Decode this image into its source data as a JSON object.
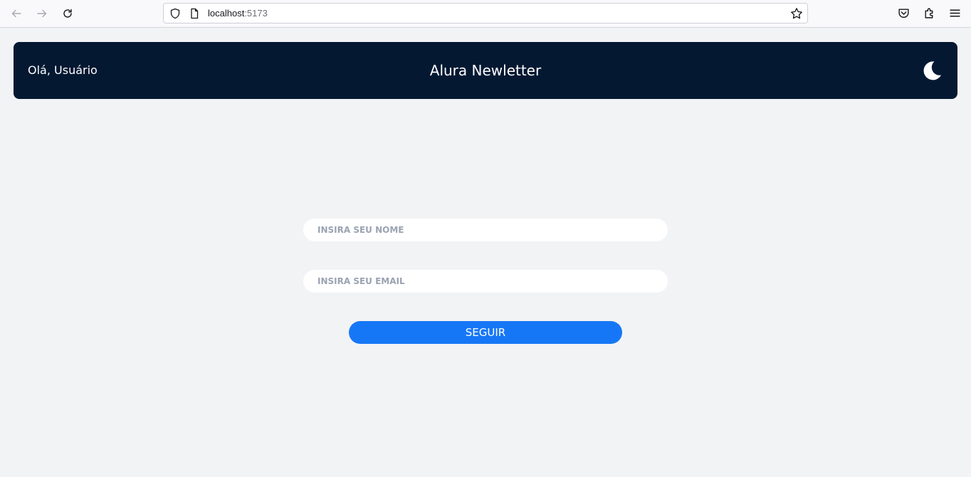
{
  "browser": {
    "url_host": "localhost",
    "url_port": ":5173"
  },
  "header": {
    "greeting": "Olá, Usuário",
    "title": "Alura Newletter",
    "theme_icon": "moon-icon"
  },
  "form": {
    "name_placeholder": "INSIRA SEU NOME",
    "email_placeholder": "INSIRA SEU EMAIL",
    "submit_label": "SEGUIR"
  },
  "colors": {
    "header_bg": "#041832",
    "page_bg": "#f2f3f5",
    "accent": "#1677f6"
  }
}
